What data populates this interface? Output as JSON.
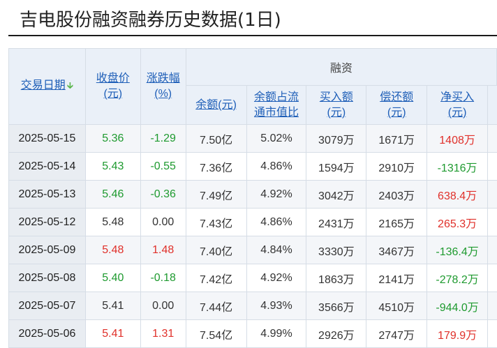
{
  "page": {
    "title": "吉电股份融资融券历史数据(1日)"
  },
  "table": {
    "group_header": "融资",
    "columns": {
      "date": "交易日期",
      "close_l1": "收盘价",
      "close_l2": "(元)",
      "chg_l1": "涨跌幅",
      "chg_l2": "(%)",
      "balance": "余额(元)",
      "ratio_l1": "余额占流",
      "ratio_l2": "通市值比",
      "buy_l1": "买入额",
      "buy_l2": "(元)",
      "repay_l1": "偿还额",
      "repay_l2": "(元)",
      "net_l1": "净买入",
      "net_l2": "(元)"
    },
    "colors": {
      "up": "#e0302a",
      "down": "#1e9a2f",
      "link": "#1f5fb8",
      "header_bg": "#eaf0f8"
    },
    "rows": [
      {
        "date": "2025-05-15",
        "close": "5.36",
        "chg": "-1.29",
        "balance": "7.50亿",
        "ratio": "5.02%",
        "buy": "3079万",
        "repay": "1671万",
        "net": "1408万",
        "close_dir": "down",
        "chg_dir": "down",
        "net_dir": "up"
      },
      {
        "date": "2025-05-14",
        "close": "5.43",
        "chg": "-0.55",
        "balance": "7.36亿",
        "ratio": "4.86%",
        "buy": "1594万",
        "repay": "2910万",
        "net": "-1316万",
        "close_dir": "down",
        "chg_dir": "down",
        "net_dir": "down"
      },
      {
        "date": "2025-05-13",
        "close": "5.46",
        "chg": "-0.36",
        "balance": "7.49亿",
        "ratio": "4.92%",
        "buy": "3042万",
        "repay": "2403万",
        "net": "638.4万",
        "close_dir": "down",
        "chg_dir": "down",
        "net_dir": "up"
      },
      {
        "date": "2025-05-12",
        "close": "5.48",
        "chg": "0.00",
        "balance": "7.43亿",
        "ratio": "4.86%",
        "buy": "2431万",
        "repay": "2165万",
        "net": "265.3万",
        "close_dir": "flat",
        "chg_dir": "flat",
        "net_dir": "up"
      },
      {
        "date": "2025-05-09",
        "close": "5.48",
        "chg": "1.48",
        "balance": "7.40亿",
        "ratio": "4.84%",
        "buy": "3330万",
        "repay": "3467万",
        "net": "-136.4万",
        "close_dir": "up",
        "chg_dir": "up",
        "net_dir": "down"
      },
      {
        "date": "2025-05-08",
        "close": "5.40",
        "chg": "-0.18",
        "balance": "7.42亿",
        "ratio": "4.92%",
        "buy": "1863万",
        "repay": "2141万",
        "net": "-278.2万",
        "close_dir": "down",
        "chg_dir": "down",
        "net_dir": "down"
      },
      {
        "date": "2025-05-07",
        "close": "5.41",
        "chg": "0.00",
        "balance": "7.44亿",
        "ratio": "4.93%",
        "buy": "3566万",
        "repay": "4510万",
        "net": "-944.0万",
        "close_dir": "flat",
        "chg_dir": "flat",
        "net_dir": "down"
      },
      {
        "date": "2025-05-06",
        "close": "5.41",
        "chg": "1.31",
        "balance": "7.54亿",
        "ratio": "4.99%",
        "buy": "2926万",
        "repay": "2747万",
        "net": "179.9万",
        "close_dir": "up",
        "chg_dir": "up",
        "net_dir": "up"
      }
    ]
  }
}
